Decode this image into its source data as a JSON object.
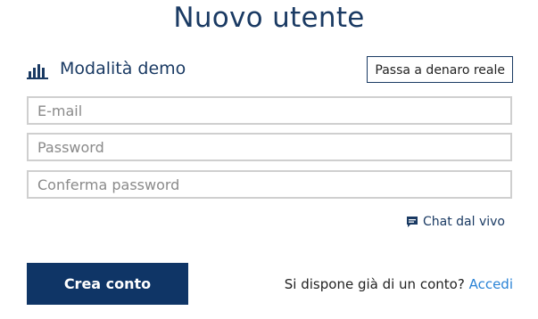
{
  "title": "Nuovo utente",
  "mode": {
    "icon": "bar-chart-icon",
    "label": "Modalità demo",
    "switch_button": "Passa a denaro reale"
  },
  "form": {
    "email_placeholder": "E-mail",
    "password_placeholder": "Password",
    "confirm_password_placeholder": "Conferma password"
  },
  "chat": {
    "icon": "chat-bubble-icon",
    "label": "Chat dal vivo"
  },
  "create_button": "Crea conto",
  "login": {
    "prompt": "Si dispone già di un conto?",
    "link": "Accedi"
  },
  "colors": {
    "primary": "#0f3566",
    "link": "#2a83d6",
    "border": "#cfcfcf"
  }
}
